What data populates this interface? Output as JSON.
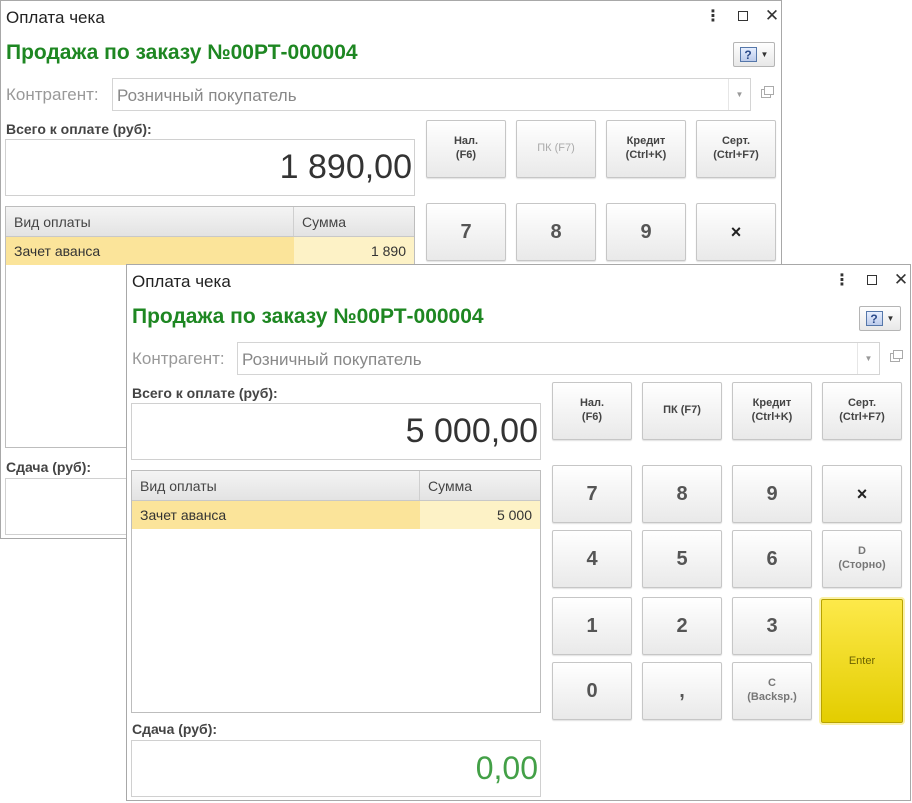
{
  "back_window": {
    "title": "Оплата чека",
    "document_title": "Продажа по заказу №00РТ-000004",
    "contractor_label": "Контрагент:",
    "contractor_value": "Розничный покупатель",
    "total_label": "Всего к оплате (руб):",
    "total_value": "1 890,00",
    "table": {
      "col_type": "Вид оплаты",
      "col_sum": "Сумма",
      "rows": [
        {
          "type": "Зачет аванса",
          "sum": "1 890"
        }
      ]
    },
    "change_label": "Сдача (руб):",
    "keypad": {
      "cash_line1": "Нал.",
      "cash_line2": "(F6)",
      "card_label": "ПК (F7)",
      "credit_line1": "Кредит",
      "credit_line2": "(Ctrl+K)",
      "cert_line1": "Серт.",
      "cert_line2": "(Ctrl+F7)",
      "d7": "7",
      "d8": "8",
      "d9": "9",
      "multiply": "×"
    }
  },
  "front_window": {
    "title": "Оплата чека",
    "document_title": "Продажа по заказу №00РТ-000004",
    "contractor_label": "Контрагент:",
    "contractor_value": "Розничный покупатель",
    "total_label": "Всего к оплате (руб):",
    "total_value": "5 000,00",
    "table": {
      "col_type": "Вид оплаты",
      "col_sum": "Сумма",
      "rows": [
        {
          "type": "Зачет аванса",
          "sum": "5 000"
        }
      ]
    },
    "change_label": "Сдача (руб):",
    "change_value": "0,00",
    "keypad": {
      "cash_line1": "Нал.",
      "cash_line2": "(F6)",
      "card_label": "ПК (F7)",
      "credit_line1": "Кредит",
      "credit_line2": "(Ctrl+K)",
      "cert_line1": "Серт.",
      "cert_line2": "(Ctrl+F7)",
      "d7": "7",
      "d8": "8",
      "d9": "9",
      "multiply": "×",
      "d4": "4",
      "d5": "5",
      "d6": "6",
      "storno_line1": "D",
      "storno_line2": "(Сторно)",
      "d1": "1",
      "d2": "2",
      "d3": "3",
      "enter": "Enter",
      "d0": "0",
      "comma": ",",
      "backsp_line1": "C",
      "backsp_line2": "(Backsp.)"
    }
  },
  "titlebar_icons": {
    "more": "more-vertical-icon",
    "maximize": "maximize-icon",
    "close": "close-icon"
  },
  "colors": {
    "accent_green": "#1e8722",
    "row_highlight": "#fbe49a",
    "enter_yellow": "#f2dc1c",
    "change_green": "#43a047"
  }
}
